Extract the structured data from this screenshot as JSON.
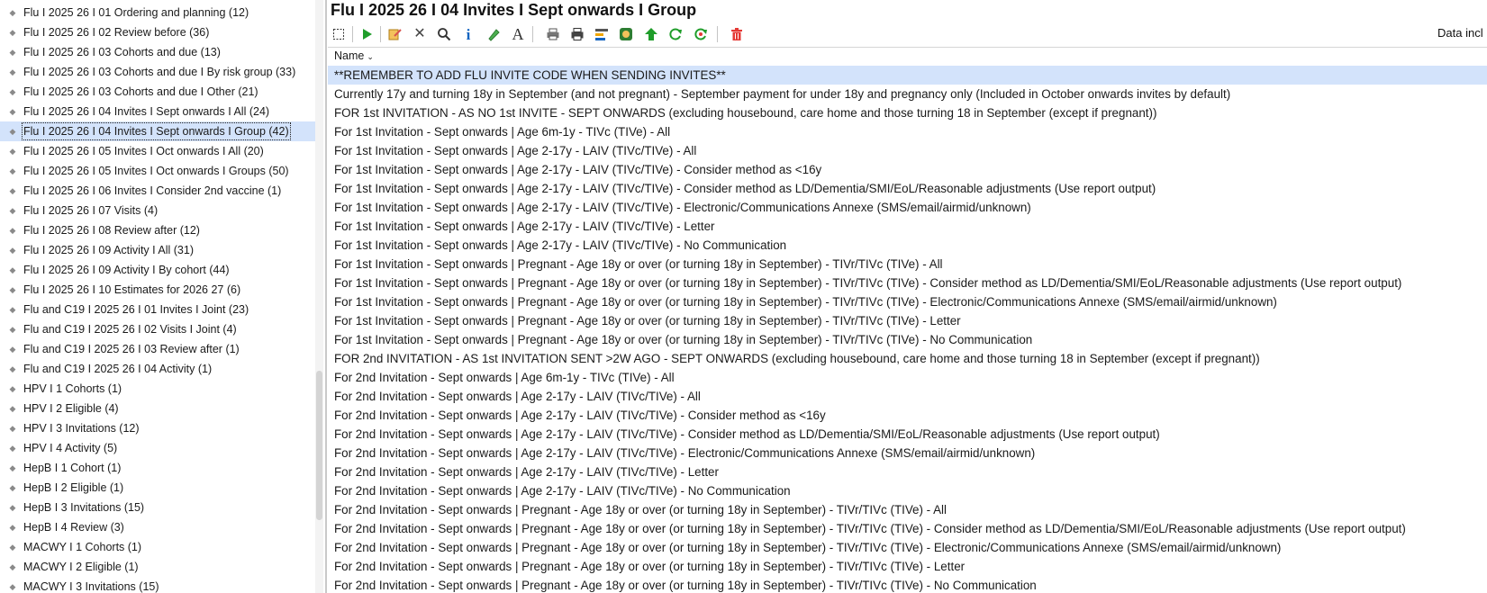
{
  "sidebar": {
    "selected_index": 6,
    "items": [
      "Flu I 2025 26 I 01 Ordering and planning (12)",
      "Flu I 2025 26 I 02 Review before (36)",
      "Flu I 2025 26 I 03 Cohorts and due (13)",
      "Flu I 2025 26 I 03 Cohorts and due I By risk group (33)",
      "Flu I 2025 26 I 03 Cohorts and due I Other (21)",
      "Flu I 2025 26 I 04 Invites I Sept onwards I All (24)",
      "Flu I 2025 26 I 04 Invites I Sept onwards I Group (42)",
      "Flu I 2025 26 I 05 Invites I Oct onwards I All (20)",
      "Flu I 2025 26 I 05 Invites I Oct onwards I Groups (50)",
      "Flu I 2025 26 I 06 Invites I Consider 2nd vaccine (1)",
      "Flu I 2025 26 I 07 Visits (4)",
      "Flu I 2025 26 I 08 Review after (12)",
      "Flu I 2025 26 I 09 Activity I All (31)",
      "Flu I 2025 26 I 09 Activity I By cohort (44)",
      "Flu I 2025 26 I 10 Estimates for 2026 27 (6)",
      "Flu and C19 I 2025 26 I 01 Invites I Joint (23)",
      "Flu and C19 I 2025 26 I 02 Visits I Joint (4)",
      "Flu and C19 I 2025 26 I 03 Review after (1)",
      "Flu and C19 I 2025 26 I 04 Activity (1)",
      "HPV I 1 Cohorts (1)",
      "HPV I 2 Eligible (4)",
      "HPV I 3 Invitations (12)",
      "HPV I 4 Activity (5)",
      "HepB I 1 Cohort (1)",
      "HepB I 2 Eligible (1)",
      "HepB I 3 Invitations (15)",
      "HepB I 4 Review (3)",
      "MACWY I 1 Cohorts (1)",
      "MACWY I 2 Eligible (1)",
      "MACWY I 3 Invitations (15)"
    ]
  },
  "main": {
    "title": "Flu I 2025 26 I 04 Invites I Sept onwards I Group",
    "data_included_label": "Data incl",
    "column_header": "Name",
    "rows": [
      "**REMEMBER TO ADD FLU INVITE CODE WHEN SENDING INVITES**",
      "Currently 17y and turning 18y in September (and not pregnant) - September payment for under 18y and pregnancy only (Included in October onwards invites by default)",
      "FOR 1st INVITATION - AS NO 1st INVITE - SEPT ONWARDS (excluding housebound, care home and those turning 18 in September (except if pregnant))",
      "For 1st Invitation - Sept onwards |  Age 6m-1y - TIVc (TIVe) - All",
      "For 1st Invitation - Sept onwards | Age 2-17y - LAIV (TIVc/TIVe) - All",
      "For 1st Invitation - Sept onwards | Age 2-17y - LAIV (TIVc/TIVe) - Consider method as <16y",
      "For 1st Invitation - Sept onwards | Age 2-17y - LAIV (TIVc/TIVe) - Consider method as LD/Dementia/SMI/EoL/Reasonable adjustments (Use report output)",
      "For 1st Invitation - Sept onwards | Age 2-17y - LAIV (TIVc/TIVe) - Electronic/Communications Annexe (SMS/email/airmid/unknown)",
      "For 1st Invitation - Sept onwards | Age 2-17y - LAIV (TIVc/TIVe) - Letter",
      "For 1st Invitation - Sept onwards | Age 2-17y - LAIV (TIVc/TIVe) - No Communication",
      "For 1st Invitation - Sept onwards | Pregnant - Age 18y or over (or turning 18y in September) - TIVr/TIVc (TIVe) - All",
      "For 1st Invitation - Sept onwards | Pregnant - Age 18y or over (or turning 18y in September) - TIVr/TIVc (TIVe) - Consider method as LD/Dementia/SMI/EoL/Reasonable adjustments (Use report output)",
      "For 1st Invitation - Sept onwards | Pregnant - Age 18y or over (or turning 18y in September) - TIVr/TIVc (TIVe) - Electronic/Communications Annexe (SMS/email/airmid/unknown)",
      "For 1st Invitation - Sept onwards | Pregnant - Age 18y or over (or turning 18y in September) - TIVr/TIVc (TIVe) - Letter",
      "For 1st Invitation - Sept onwards | Pregnant - Age 18y or over (or turning 18y in September) - TIVr/TIVc (TIVe) - No Communication",
      "FOR 2nd INVITATION - AS 1st INVITATION SENT >2W AGO - SEPT ONWARDS (excluding housebound, care home and those turning 18 in September (except if pregnant))",
      "For 2nd Invitation - Sept onwards |  Age 6m-1y - TIVc (TIVe) - All",
      "For 2nd Invitation - Sept onwards | Age 2-17y - LAIV (TIVc/TIVe) - All",
      "For 2nd Invitation - Sept onwards | Age 2-17y - LAIV (TIVc/TIVe) - Consider method as <16y",
      "For 2nd Invitation - Sept onwards | Age 2-17y - LAIV (TIVc/TIVe) - Consider method as LD/Dementia/SMI/EoL/Reasonable adjustments (Use report output)",
      "For 2nd Invitation - Sept onwards | Age 2-17y - LAIV (TIVc/TIVe) - Electronic/Communications Annexe (SMS/email/airmid/unknown)",
      "For 2nd Invitation - Sept onwards | Age 2-17y - LAIV (TIVc/TIVe) - Letter",
      "For 2nd Invitation - Sept onwards | Age 2-17y - LAIV (TIVc/TIVe) - No Communication",
      "For 2nd Invitation - Sept onwards | Pregnant - Age 18y or over (or turning 18y in September) - TIVr/TIVc (TIVe) - All",
      "For 2nd Invitation - Sept onwards | Pregnant - Age 18y or over (or turning 18y in September) - TIVr/TIVc (TIVe) - Consider method as LD/Dementia/SMI/EoL/Reasonable adjustments (Use report output)",
      "For 2nd Invitation - Sept onwards | Pregnant - Age 18y or over (or turning 18y in September) - TIVr/TIVc (TIVe) - Electronic/Communications Annexe (SMS/email/airmid/unknown)",
      "For 2nd Invitation - Sept onwards | Pregnant - Age 18y or over (or turning 18y in September) - TIVr/TIVc (TIVe) - Letter",
      "For 2nd Invitation - Sept onwards | Pregnant - Age 18y or over (or turning 18y in September) - TIVr/TIVc (TIVe) - No Communication"
    ]
  },
  "toolbar": {
    "icons": [
      "select-icon",
      "run-icon",
      "edit-icon",
      "delete-icon",
      "search-icon",
      "info-icon",
      "pen-icon",
      "font-icon",
      "print-icon",
      "print-all-icon",
      "report-icon",
      "badge-icon",
      "upload-icon",
      "refresh-icon",
      "refresh-all-icon",
      "trash-icon"
    ]
  },
  "colors": {
    "selection": "#d3e3fb",
    "run": "#1f9d2a",
    "info": "#1565c0",
    "trash": "#e53935"
  }
}
